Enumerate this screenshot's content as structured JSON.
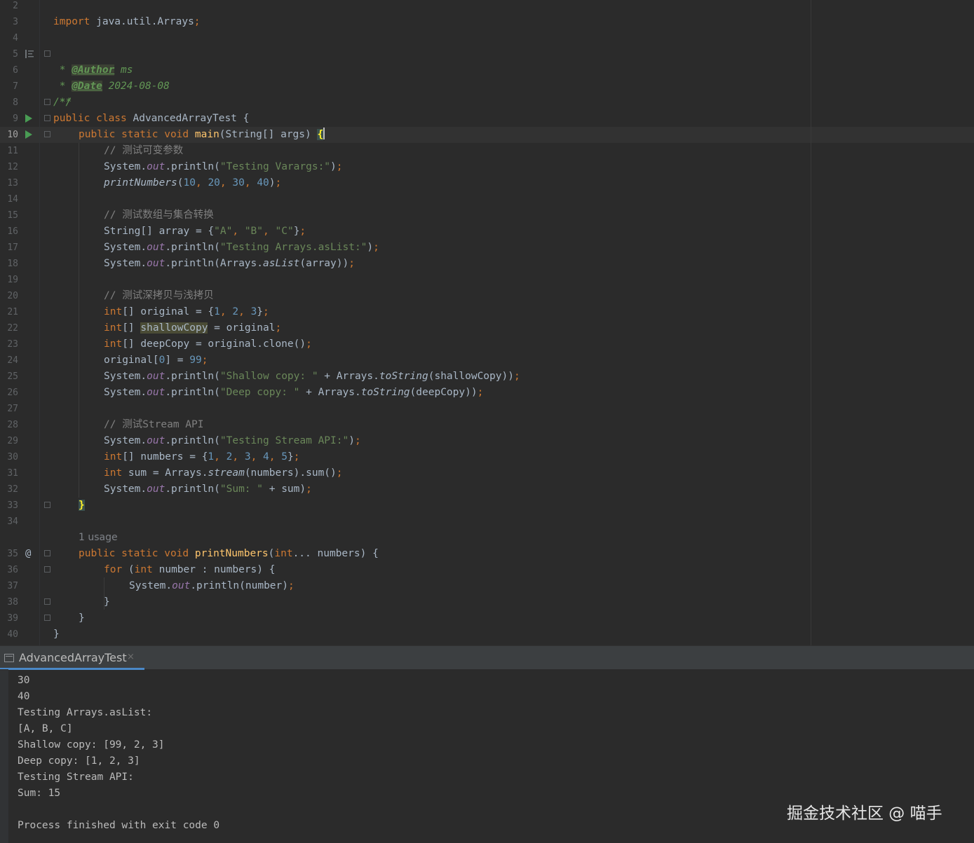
{
  "editor": {
    "lines": {
      "l2": "2",
      "l3": "3",
      "l4": "4",
      "l5": "5",
      "l6": "6",
      "l7": "7",
      "l8": "8",
      "l9": "9",
      "l10": "10",
      "l11": "11",
      "l12": "12",
      "l13": "13",
      "l14": "14",
      "l15": "15",
      "l16": "16",
      "l17": "17",
      "l18": "18",
      "l19": "19",
      "l20": "20",
      "l21": "21",
      "l22": "22",
      "l23": "23",
      "l24": "24",
      "l25": "25",
      "l26": "26",
      "l27": "27",
      "l28": "28",
      "l29": "29",
      "l30": "30",
      "l31": "31",
      "l32": "32",
      "l33": "33",
      "l34": "34",
      "l35": "35",
      "l36": "36",
      "l37": "37",
      "l38": "38",
      "l39": "39",
      "l40": "40"
    },
    "usage_hint": "1 usage",
    "tokens": {
      "t3": {
        "a": "import",
        "b": " java.util.Arrays",
        "c": ";"
      },
      "t5": {
        "a": "/**"
      },
      "t6": {
        "a": " * ",
        "b": "@Author",
        "c": " ms"
      },
      "t7": {
        "a": " * ",
        "b": "@Date",
        "c": " 2024-08-08"
      },
      "t8": {
        "a": " */"
      },
      "t9": {
        "a": "public class",
        "b": " AdvancedArrayTest {"
      },
      "t10": {
        "a": "public static void",
        "b": " ",
        "c": "main",
        "d": "(String[] args) ",
        "e": "{"
      },
      "t11": {
        "a": "// 测试可变参数"
      },
      "t12": {
        "a": "System.",
        "b": "out",
        "c": ".println(",
        "d": "\"Testing Varargs:\"",
        "e": ")",
        "f": ";"
      },
      "t13": {
        "a": "printNumbers",
        "b": "(",
        "c": "10",
        "d": ", ",
        "e": "20",
        "f": ", ",
        "g": "30",
        "h": ", ",
        "i": "40",
        "j": ")",
        "k": ";"
      },
      "t15": {
        "a": "// 测试数组与集合转换"
      },
      "t16": {
        "a": "String[] array = {",
        "b": "\"A\"",
        "c": ", ",
        "d": "\"B\"",
        "e": ", ",
        "f": "\"C\"",
        "g": "}",
        "h": ";"
      },
      "t17": {
        "a": "System.",
        "b": "out",
        "c": ".println(",
        "d": "\"Testing Arrays.asList:\"",
        "e": ")",
        "f": ";"
      },
      "t18": {
        "a": "System.",
        "b": "out",
        "c": ".println(Arrays.",
        "d": "asList",
        "e": "(array))",
        "f": ";"
      },
      "t20": {
        "a": "// 测试深拷贝与浅拷贝"
      },
      "t21": {
        "a": "int",
        "b": "[] original = {",
        "c": "1",
        "d": ", ",
        "e": "2",
        "f": ", ",
        "g": "3",
        "h": "}",
        "i": ";"
      },
      "t22": {
        "a": "int",
        "b": "[] ",
        "c": "shallowCopy",
        "d": " = original",
        "e": ";"
      },
      "t23": {
        "a": "int",
        "b": "[] deepCopy = original.clone()",
        "c": ";"
      },
      "t24": {
        "a": "original[",
        "b": "0",
        "c": "] = ",
        "d": "99",
        "e": ";"
      },
      "t25": {
        "a": "System.",
        "b": "out",
        "c": ".println(",
        "d": "\"Shallow copy: \"",
        "e": " + Arrays.",
        "f": "toString",
        "g": "(shallowCopy))",
        "h": ";"
      },
      "t26": {
        "a": "System.",
        "b": "out",
        "c": ".println(",
        "d": "\"Deep copy: \"",
        "e": " + Arrays.",
        "f": "toString",
        "g": "(deepCopy))",
        "h": ";"
      },
      "t28": {
        "a": "// 测试Stream API"
      },
      "t29": {
        "a": "System.",
        "b": "out",
        "c": ".println(",
        "d": "\"Testing Stream API:\"",
        "e": ")",
        "f": ";"
      },
      "t30": {
        "a": "int",
        "b": "[] numbers = {",
        "c": "1",
        "d": ", ",
        "e": "2",
        "f": ", ",
        "g": "3",
        "h": ", ",
        "i": "4",
        "j": ", ",
        "k": "5",
        "l": "}",
        "m": ";"
      },
      "t31": {
        "a": "int",
        "b": " sum = Arrays.",
        "c": "stream",
        "d": "(numbers).sum()",
        "e": ";"
      },
      "t32": {
        "a": "System.",
        "b": "out",
        "c": ".println(",
        "d": "\"Sum: \"",
        "e": " + sum)",
        "f": ";"
      },
      "t33": {
        "a": "}"
      },
      "t35": {
        "a": "public static void",
        "b": " ",
        "c": "printNumbers",
        "d": "(",
        "e": "int",
        "f": "... numbers) {"
      },
      "t36": {
        "a": "for",
        "b": " (",
        "c": "int",
        "d": " number : numbers) {"
      },
      "t37": {
        "a": "System.",
        "b": "out",
        "c": ".println(number)",
        "d": ";"
      },
      "t38": {
        "a": "}"
      },
      "t39": {
        "a": "}"
      },
      "t40": {
        "a": "}"
      }
    }
  },
  "run_panel": {
    "tab_label": "AdvancedArrayTest",
    "tab_close": "×",
    "output": {
      "o1": "30",
      "o2": "40",
      "o3": "Testing Arrays.asList:",
      "o4": "[A, B, C]",
      "o5": "Shallow copy: [99, 2, 3]",
      "o6": "Deep copy: [1, 2, 3]",
      "o7": "Testing Stream API:",
      "o8": "Sum: 15",
      "o9": "Process finished with exit code 0"
    }
  },
  "watermark": "掘金技术社区 @ 喵手",
  "icons": {
    "at_marker": "@"
  },
  "colors": {
    "background": "#2b2b2b",
    "keyword": "#cc7832",
    "string": "#6a8759",
    "number": "#6897bb",
    "function": "#ffc66d",
    "static_field": "#9876aa",
    "comment": "#808080",
    "run_icon": "#499c54"
  }
}
